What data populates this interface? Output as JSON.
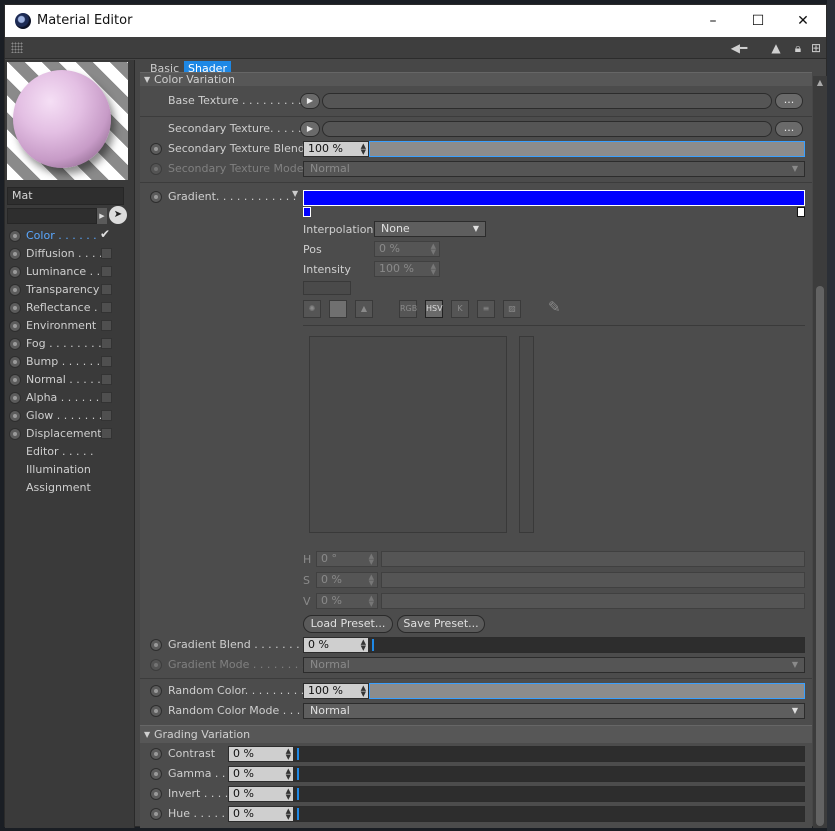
{
  "window": {
    "title": "Material Editor",
    "minimize": "–",
    "maximize": "☐",
    "close": "✕"
  },
  "left": {
    "material_name": "Mat",
    "channels": [
      {
        "label": "Color . . . . . .",
        "active": true,
        "checked": true
      },
      {
        "label": "Diffusion . . . .",
        "active": false
      },
      {
        "label": "Luminance . .",
        "active": false
      },
      {
        "label": "Transparency",
        "active": false
      },
      {
        "label": "Reflectance . .",
        "active": false
      },
      {
        "label": "Environment",
        "active": false
      },
      {
        "label": "Fog . . . . . . . .",
        "active": false
      },
      {
        "label": "Bump . . . . . .",
        "active": false
      },
      {
        "label": "Normal . . . . .",
        "active": false
      },
      {
        "label": "Alpha . . . . . .",
        "active": false
      },
      {
        "label": "Glow . . . . . . .",
        "active": false
      },
      {
        "label": "Displacement",
        "active": false
      }
    ],
    "extra": [
      "Editor . . . . .",
      "Illumination",
      "Assignment"
    ]
  },
  "tabs": {
    "basic": "Basic",
    "shader": "Shader"
  },
  "color_variation": {
    "header": "Color Variation",
    "base_texture": "Base Texture . . . . . . . . . .",
    "secondary_texture": "Secondary Texture. . . . . .",
    "secondary_blend_label": "Secondary Texture Blend",
    "secondary_blend_value": "100 %",
    "secondary_mode_label": "Secondary Texture Mode",
    "secondary_mode_value": "Normal",
    "dots": "...",
    "gradient_label": "Gradient. . . . . . . . . . . .",
    "interpolation_label": "Interpolation",
    "interpolation_value": "None",
    "pos_label": "Pos",
    "pos_value": "0 %",
    "intensity_label": "Intensity",
    "intensity_value": "100 %",
    "mode_buttons": [
      "RGB",
      "HSV",
      "K"
    ],
    "h_label": "H",
    "h_value": "0 °",
    "s_label": "S",
    "s_value": "0 %",
    "v_label": "V",
    "v_value": "0 %",
    "load_preset": "Load Preset...",
    "save_preset": "Save Preset...",
    "gradient_blend_label": "Gradient Blend . . . . . . . .",
    "gradient_blend_value": "0 %",
    "gradient_mode_label": "Gradient Mode . . . . . . . .",
    "gradient_mode_value": "Normal",
    "random_color_label": "Random Color. . . . . . . . .",
    "random_color_value": "100 %",
    "random_mode_label": "Random Color Mode . . .",
    "random_mode_value": "Normal"
  },
  "grading_variation": {
    "header": "Grading Variation",
    "rows": [
      {
        "label": "Contrast",
        "value": "0 %"
      },
      {
        "label": "Gamma . .",
        "value": "0 %"
      },
      {
        "label": "Invert . . . .",
        "value": "0 %"
      },
      {
        "label": "Hue . . . . . .",
        "value": "0 %"
      }
    ]
  },
  "colors": {
    "accent": "#1e88e5",
    "gradient": "#0000ff",
    "panel": "#4c4c4c"
  }
}
